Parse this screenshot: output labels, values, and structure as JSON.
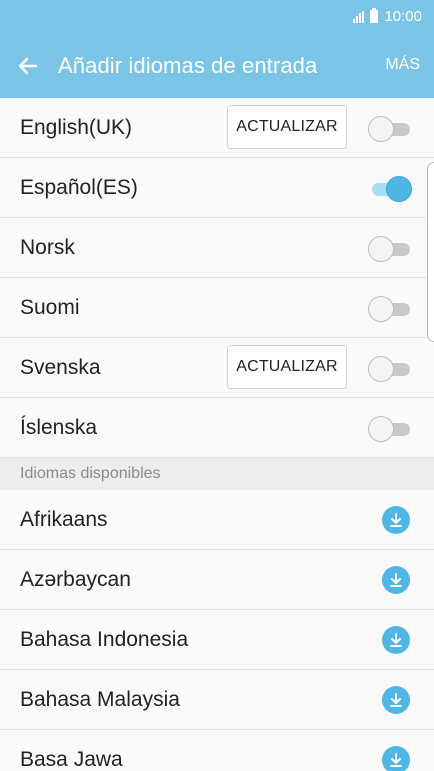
{
  "status_bar": {
    "time": "10:00"
  },
  "app_bar": {
    "title": "Añadir idiomas de entrada",
    "more_label": "MÁS"
  },
  "installed_languages": [
    {
      "label": "English(UK)",
      "update_label": "ACTUALIZAR",
      "enabled": false
    },
    {
      "label": "Español(ES)",
      "enabled": true
    },
    {
      "label": "Norsk",
      "enabled": false
    },
    {
      "label": "Suomi",
      "enabled": false
    },
    {
      "label": "Svenska",
      "update_label": "ACTUALIZAR",
      "enabled": false
    },
    {
      "label": "Íslenska",
      "enabled": false
    }
  ],
  "available_section": {
    "header": "Idiomas disponibles"
  },
  "available_languages": [
    {
      "label": "Afrikaans"
    },
    {
      "label": "Azərbaycan"
    },
    {
      "label": "Bahasa Indonesia"
    },
    {
      "label": "Bahasa Malaysia"
    },
    {
      "label": "Basa Jawa"
    }
  ],
  "colors": {
    "accent": "#4fb6e6",
    "app_bar": "#7cc4e6"
  }
}
